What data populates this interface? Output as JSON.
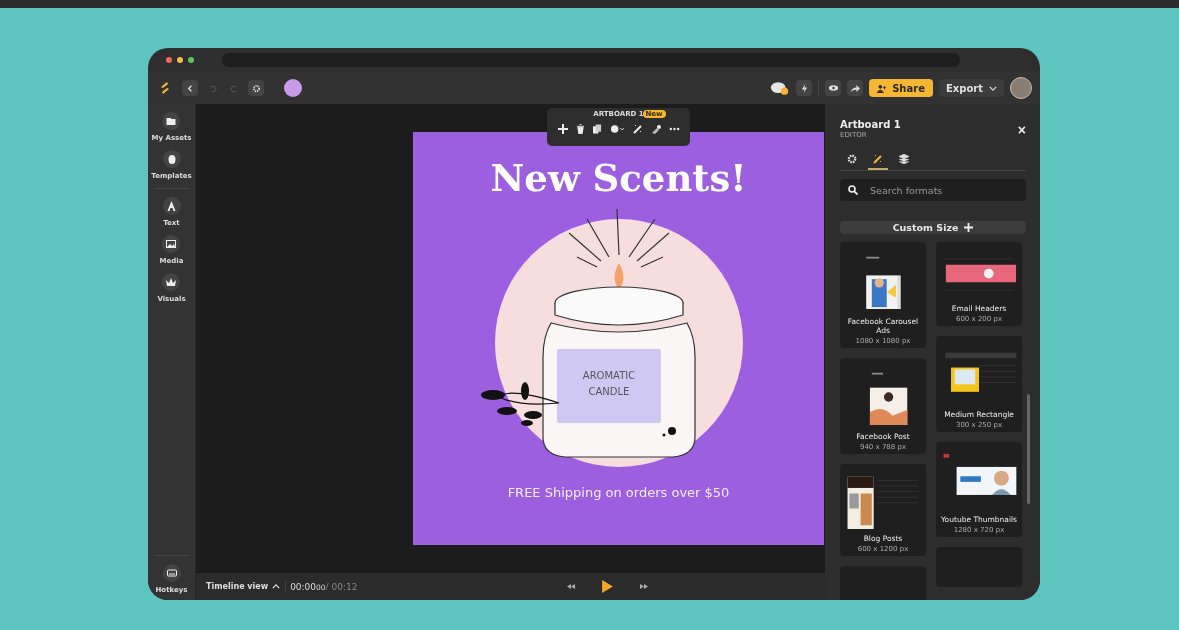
{
  "toolbar": {
    "share": "Share",
    "export": "Export"
  },
  "sidebar": {
    "items": [
      {
        "label": "My Assets"
      },
      {
        "label": "Templates"
      },
      {
        "label": "Text"
      },
      {
        "label": "Media"
      },
      {
        "label": "Visuals"
      }
    ],
    "bottom": {
      "label": "Hotkeys"
    }
  },
  "floating_toolbar": {
    "label": "ARTBOARD 1",
    "badge": "New"
  },
  "artboard": {
    "title": "New Scents!",
    "jar_label": [
      "AROMATIC",
      "CANDLE"
    ],
    "footer": "FREE Shipping on orders over $50"
  },
  "timeline": {
    "label": "Timeline view",
    "current": "00:00",
    "frames": "00",
    "total": "/ 00:12"
  },
  "panel": {
    "title": "Artboard 1",
    "subtitle": "EDITOR",
    "close": "×",
    "tabs": [
      {
        "selected": false
      },
      {
        "selected": true
      },
      {
        "selected": false
      }
    ],
    "search": {
      "placeholder": "Search formats"
    },
    "custom_size": "Custom Size",
    "columns": [
      {
        "cards": [
          {
            "title": "Facebook Carousel Ads",
            "size": "1080 x 1080 px",
            "kind": "portrait"
          },
          {
            "title": "Facebook Post",
            "size": "940 x 788 px",
            "kind": "square"
          },
          {
            "title": "Blog Posts",
            "size": "600 x 1200 px",
            "kind": "blog"
          }
        ]
      },
      {
        "cards": [
          {
            "title": "Email Headers",
            "size": "600 x 200 px",
            "kind": "banner"
          },
          {
            "title": "Medium Rectangle",
            "size": "300 x 250 px",
            "kind": "rectangle"
          },
          {
            "title": "Youtube Thumbnails",
            "size": "1280 x 720 px",
            "kind": "video"
          }
        ]
      }
    ]
  }
}
